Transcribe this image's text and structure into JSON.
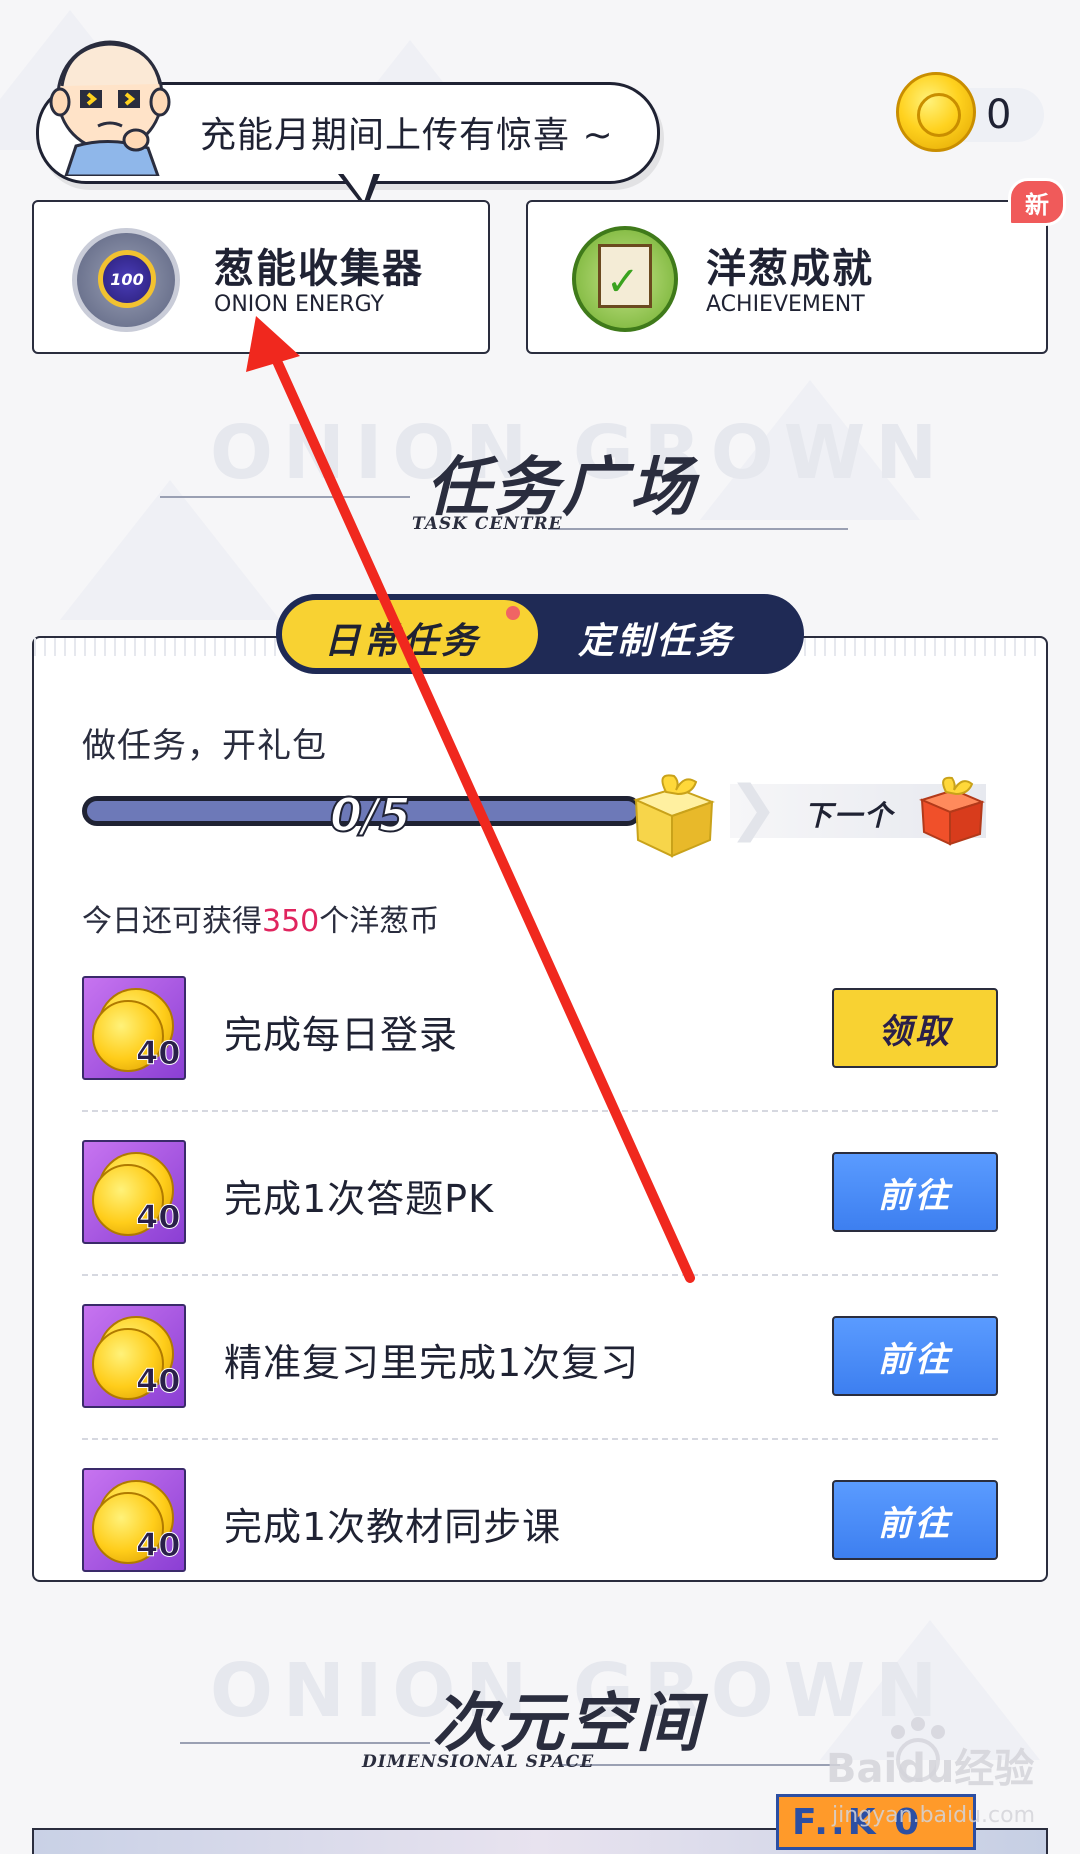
{
  "header": {
    "speech_bubble": "充能月期间上传有惊喜 ~",
    "coin_count": "0"
  },
  "feature_cards": [
    {
      "title": "葱能收集器",
      "subtitle": "ONION ENERGY",
      "icon": "onion-energy-badge-icon",
      "badge_value": "100"
    },
    {
      "title": "洋葱成就",
      "subtitle": "ACHIEVEMENT",
      "icon": "achievement-checklist-icon",
      "badge": "新"
    }
  ],
  "task_centre": {
    "title": "任务广场",
    "subtitle": "TASK CENTRE",
    "watermark": "ONION GROWN",
    "tabs": [
      {
        "label": "日常任务",
        "active": true,
        "dot": true
      },
      {
        "label": "定制任务",
        "active": false
      }
    ],
    "heading": "做任务，开礼包",
    "progress": {
      "text": "0/5",
      "current": 0,
      "total": 5
    },
    "next_label": "下一个",
    "remaining_prefix": "今日还可获得",
    "remaining_amount": "350",
    "remaining_suffix": "个洋葱币",
    "tasks": [
      {
        "reward": "40",
        "name": "完成每日登录",
        "button": "领取",
        "button_style": "yellow"
      },
      {
        "reward": "40",
        "name": "完成1次答题PK",
        "button": "前往",
        "button_style": "blue"
      },
      {
        "reward": "40",
        "name": "精准复习里完成1次复习",
        "button": "前往",
        "button_style": "blue"
      },
      {
        "reward": "40",
        "name": "完成1次教材同步课",
        "button": "前往",
        "button_style": "blue"
      }
    ]
  },
  "dimensional_space": {
    "title": "次元空间",
    "subtitle": "DIMENSIONAL SPACE",
    "watermark": "ONION GROWN"
  },
  "bottom_tag_text": "F..K 0",
  "site_watermark": {
    "brand": "Baidu经验",
    "url": "jingyan.baidu.com"
  },
  "colors": {
    "accent_yellow": "#f8d232",
    "tab_navy": "#1f2a55",
    "button_blue": "#3d7ff0",
    "highlight_red": "#e0245e",
    "annotation_arrow": "#f0281e"
  }
}
